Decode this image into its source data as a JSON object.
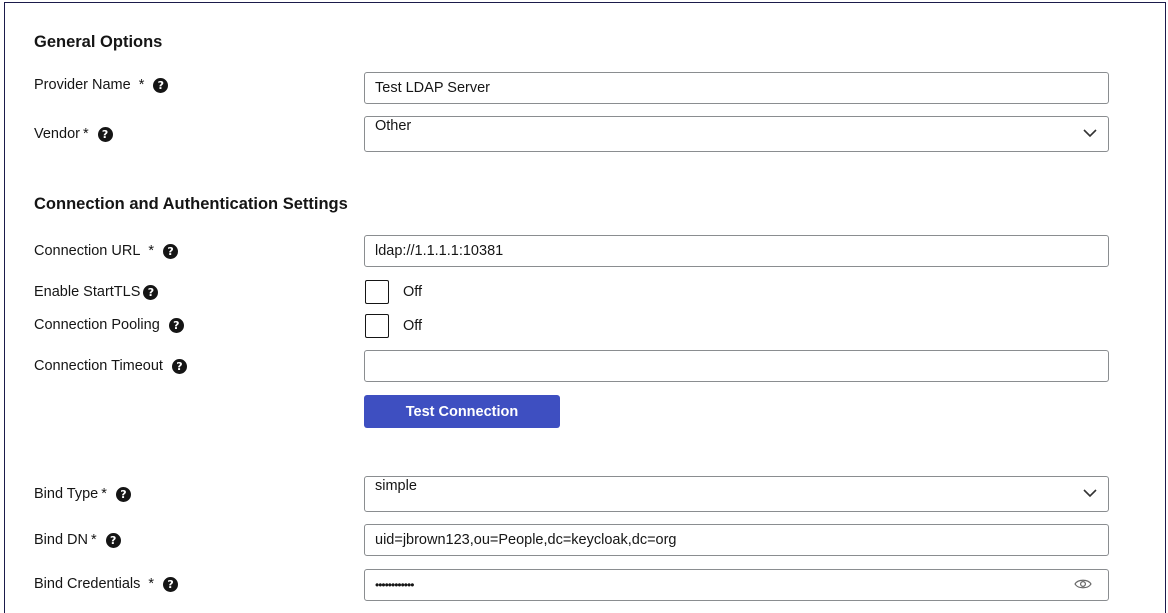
{
  "general": {
    "title": "General Options",
    "provider_name": {
      "label": "Provider Name",
      "required": "*",
      "help": "?",
      "value": "Test LDAP Server"
    },
    "vendor": {
      "label": "Vendor",
      "required": "*",
      "help": "?",
      "value": "Other"
    }
  },
  "connection": {
    "title": "Connection and Authentication Settings",
    "url": {
      "label": "Connection URL",
      "required": "*",
      "help": "?",
      "value": "ldap://1.1.1.1:10381"
    },
    "starttls": {
      "label": "Enable StartTLS",
      "help": "?",
      "state": "Off"
    },
    "pooling": {
      "label": "Connection Pooling",
      "help": "?",
      "state": "Off"
    },
    "timeout": {
      "label": "Connection Timeout",
      "help": "?",
      "value": ""
    },
    "test_button": "Test Connection",
    "bind_type": {
      "label": "Bind Type",
      "required": "*",
      "help": "?",
      "value": "simple"
    },
    "bind_dn": {
      "label": "Bind DN",
      "required": "*",
      "help": "?",
      "value": "uid=jbrown123,ou=People,dc=keycloak,dc=org"
    },
    "bind_credentials": {
      "label": "Bind Credentials",
      "required": "*",
      "help": "?",
      "value": "••••••••••••"
    }
  },
  "icons": {
    "help": "question-circle-icon",
    "chevron": "chevron-down-icon",
    "eye": "eye-icon"
  }
}
